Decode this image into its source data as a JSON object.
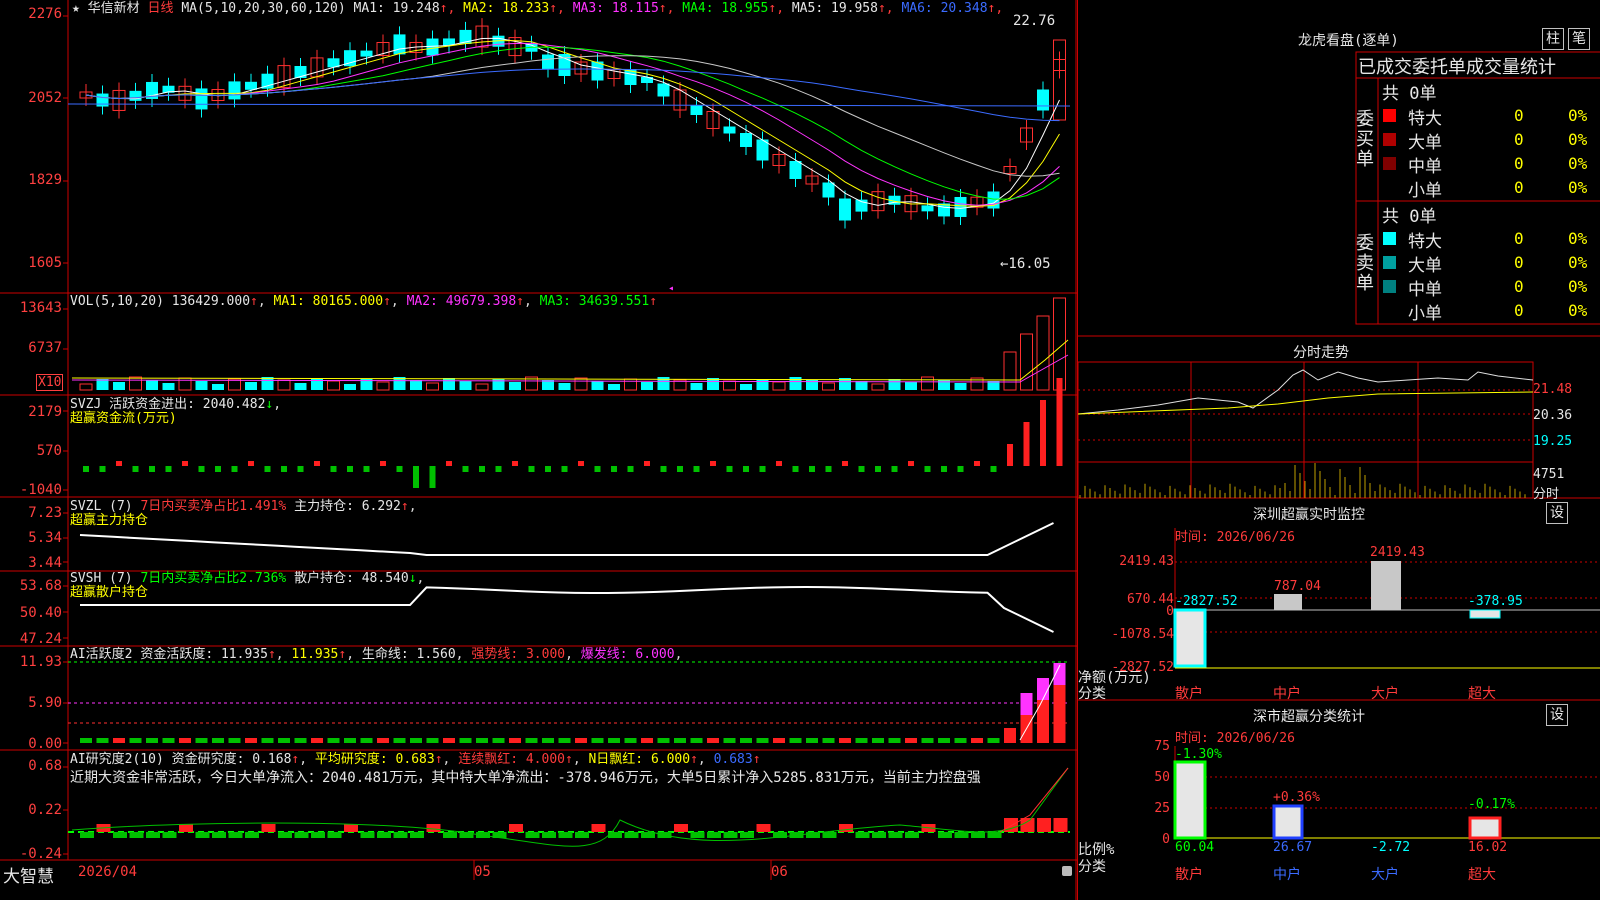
{
  "stock": {
    "name": "华信新材",
    "period": "日线"
  },
  "ma_header": {
    "label": "MA(5,10,20,30,60,120)",
    "items": [
      {
        "text": "MA1: 19.248",
        "color": "#e6e6e6"
      },
      {
        "text": "MA2: 18.233",
        "color": "#ffff00"
      },
      {
        "text": "MA3: 18.115",
        "color": "#ff33ff"
      },
      {
        "text": "MA4: 18.955",
        "color": "#00ff00"
      },
      {
        "text": "MA5: 19.958",
        "color": "#e6e6e6"
      },
      {
        "text": "MA6: 20.348",
        "color": "#3b6bff"
      }
    ]
  },
  "price_axis": [
    "2276",
    "2052",
    "1829",
    "1605"
  ],
  "price_high_note": "22.76",
  "price_low_note": "←16.05",
  "vol_panel": {
    "header": "VOL(5,10,20)",
    "value": "136429.000",
    "ma1": "MA1: 80165.000",
    "ma2": "MA2: 49679.398",
    "ma3": "MA3: 34639.551",
    "axis": [
      "13643",
      "6737"
    ],
    "unit": "X10"
  },
  "svzj_panel": {
    "header": "SVZJ",
    "line1": "活跃资金进出: 2040.482",
    "line2": "超赢资金流(万元)",
    "axis": [
      "2179",
      "570",
      "-1040"
    ]
  },
  "svzl_panel": {
    "header": "SVZL (7)",
    "ratio": "7日内买卖净占比1.491%",
    "hold": "主力持仓: 6.292",
    "line2": "超赢主力持仓",
    "axis": [
      "7.23",
      "5.34",
      "3.44"
    ]
  },
  "svsh_panel": {
    "header": "SVSH (7)",
    "ratio": "7日内买卖净占比2.736%",
    "hold": "散户持仓: 48.540",
    "line2": "超赢散户持仓",
    "axis": [
      "53.68",
      "50.40",
      "47.24"
    ]
  },
  "ai1_panel": {
    "header": "AI活跃度2",
    "a": "资金活跃度: 11.935",
    "b": "11.935",
    "c": "生命线: 1.560",
    "d": "强势线: 3.000",
    "e": "爆发线: 6.000",
    "axis": [
      "11.93",
      "5.90",
      "0.00"
    ]
  },
  "ai2_panel": {
    "header": "AI研究度2(10)",
    "a": "资金研究度: 0.168",
    "b": "平均研究度: 0.683",
    "c": "连续飘红: 4.000",
    "d": "N日飘红: 6.000",
    "e": "0.683",
    "comment": "近期大资金非常活跃，今日大单净流入：2040.481万元，其中特大单净流出：-378.946万元，大单5日累计净入5285.831万元，当前主力控盘强",
    "axis": [
      "0.68",
      "0.22",
      "-0.24"
    ]
  },
  "date_axis": [
    "2026/04",
    "05",
    "06"
  ],
  "brand": "大智慧",
  "longhu": {
    "title": "龙虎看盘(逐单)",
    "btn1": "柱",
    "btn2": "笔",
    "subtitle": "已成交委托单成交量统计",
    "buy_label": "委买单",
    "sell_label": "委卖单",
    "buy_total": "共 0单",
    "sell_total": "共 0单",
    "rows": [
      {
        "name": "特大",
        "count": "0",
        "pct": "0%"
      },
      {
        "name": "大单",
        "count": "0",
        "pct": "0%"
      },
      {
        "name": "中单",
        "count": "0",
        "pct": "0%"
      },
      {
        "name": "小单",
        "count": "0",
        "pct": "0%"
      }
    ]
  },
  "intraday": {
    "title": "分时走势",
    "axis": [
      "21.48",
      "20.36",
      "19.25",
      "4751",
      "分时"
    ]
  },
  "monitor": {
    "title": "深圳超赢实时监控",
    "btn": "设",
    "time": "时间: 2026/06/26",
    "axis": [
      "2419.43",
      "670.44",
      "0",
      "-1078.54",
      "-2827.52"
    ],
    "ylabel": "净额(万元)",
    "xlabel": "分类",
    "cats": [
      "散户",
      "中户",
      "大户",
      "超大"
    ],
    "values": [
      "-2827.52",
      "787.04",
      "2419.43",
      "-378.95"
    ]
  },
  "classify": {
    "title": "深市超赢分类统计",
    "btn": "设",
    "time": "时间: 2026/06/26",
    "axis": [
      "75",
      "50",
      "25",
      "0"
    ],
    "ylabel": "比例%",
    "xlabel": "分类",
    "cats": [
      "散户",
      "中户",
      "大户",
      "超大"
    ],
    "pct_labels": [
      "-1.30%",
      "+0.36%",
      "",
      "-0.17%"
    ],
    "bottom_vals": [
      "60.04",
      "26.67",
      "-2.72",
      "16.02"
    ]
  }
}
